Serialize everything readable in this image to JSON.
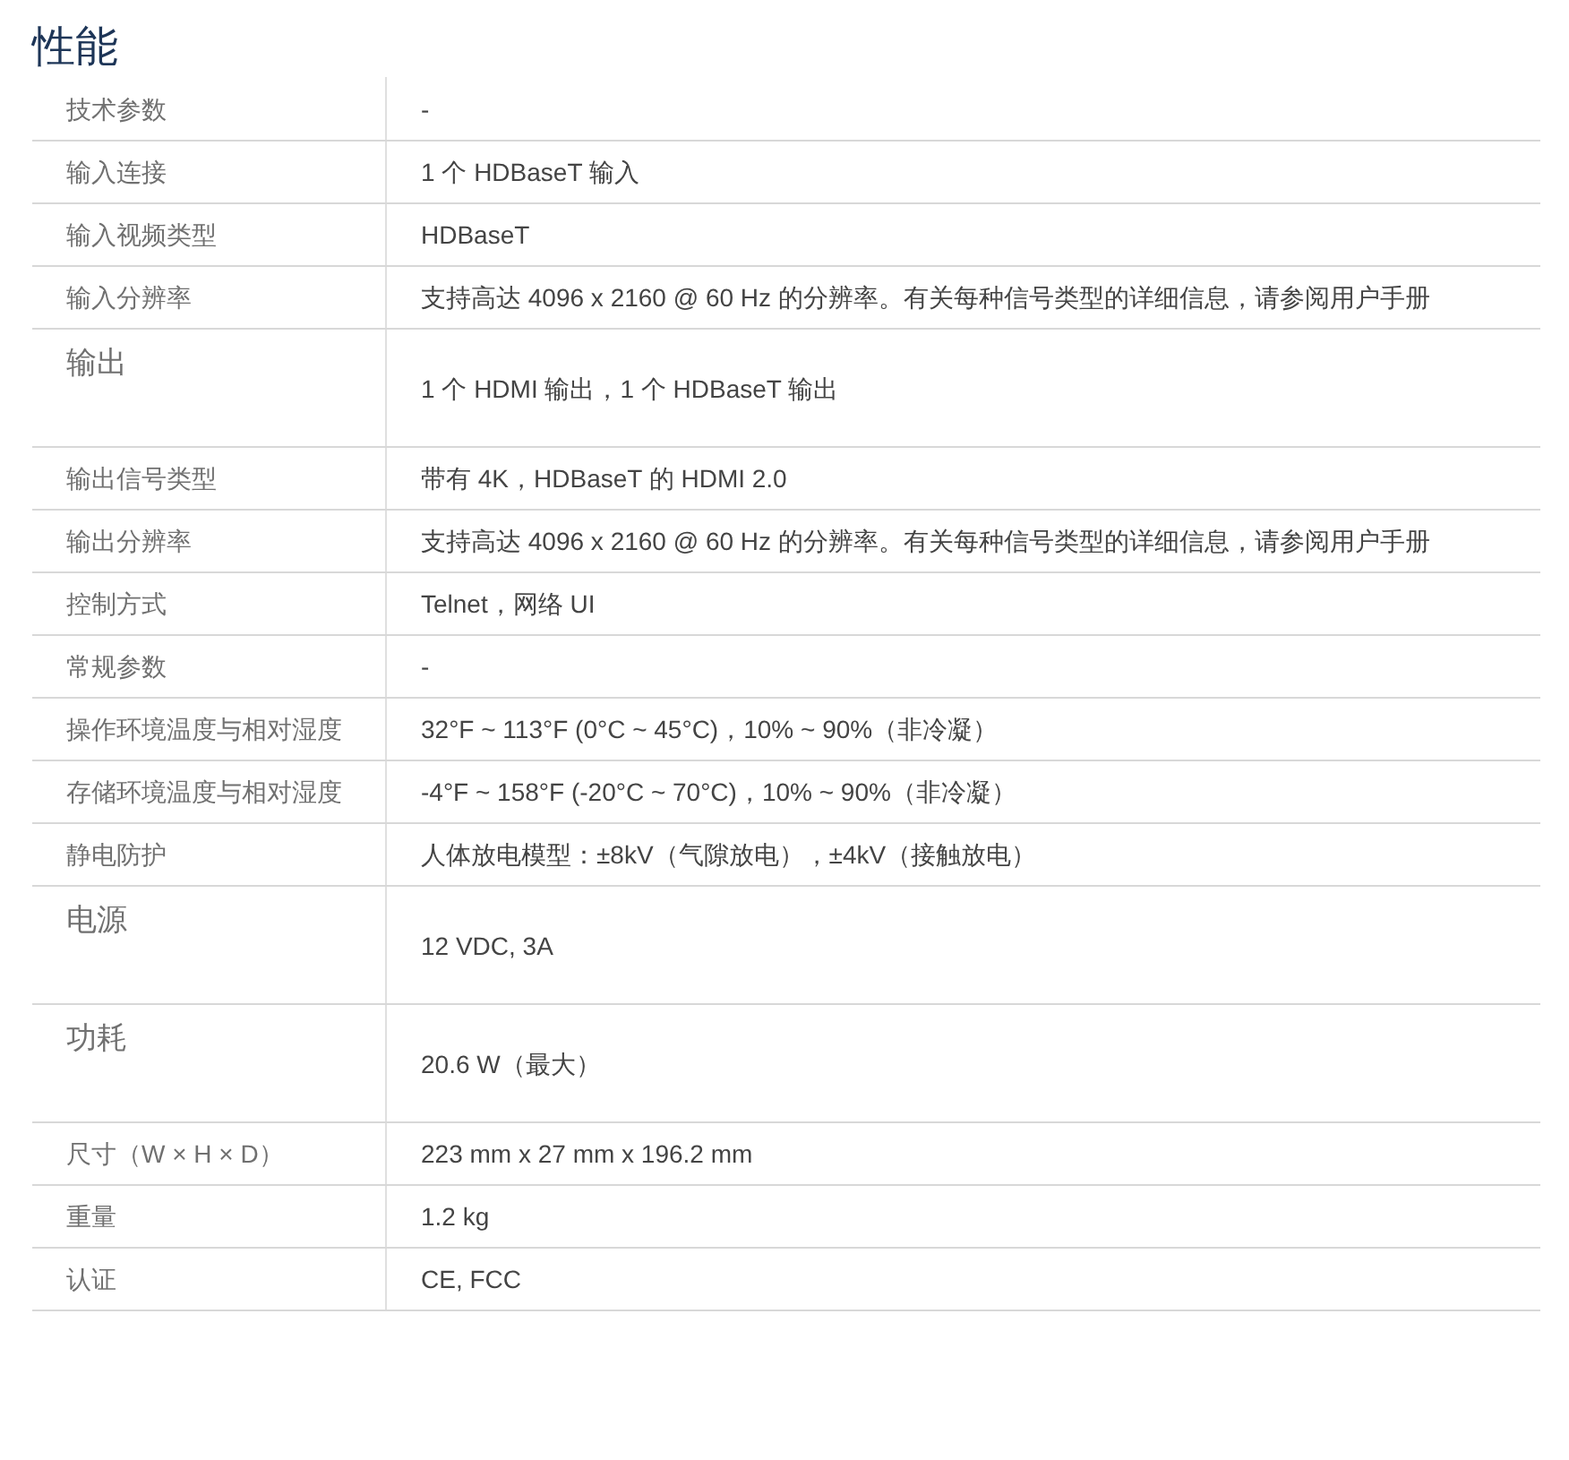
{
  "title": "性能",
  "rows": [
    {
      "label": "技术参数",
      "value": "-",
      "kind": "plain"
    },
    {
      "label": "输入连接",
      "value": "1 个 HDBaseT 输入",
      "kind": "plain"
    },
    {
      "label": "输入视频类型",
      "value": "HDBaseT",
      "kind": "plain"
    },
    {
      "label": "输入分辨率",
      "value": "支持高达 4096 x 2160 @ 60 Hz 的分辨率。有关每种信号类型的详细信息，请参阅用户手册",
      "kind": "plain"
    },
    {
      "label": "输出",
      "value": "1 个 HDMI 输出，1 个 HDBaseT 输出",
      "kind": "tall"
    },
    {
      "label": "输出信号类型",
      "value": "带有 4K，HDBaseT 的 HDMI 2.0",
      "kind": "plain"
    },
    {
      "label": "输出分辨率",
      "value": "支持高达 4096 x 2160 @ 60 Hz 的分辨率。有关每种信号类型的详细信息，请参阅用户手册",
      "kind": "plain"
    },
    {
      "label": "控制方式",
      "value": "Telnet，网络 UI",
      "kind": "plain"
    },
    {
      "label": "常规参数",
      "value": "-",
      "kind": "plain"
    },
    {
      "label": "操作环境温度与相对湿度",
      "value": "32°F ~ 113°F (0°C ~ 45°C)，10% ~ 90%（非冷凝）",
      "kind": "plain"
    },
    {
      "label": "存储环境温度与相对湿度",
      "value": "-4°F ~ 158°F (-20°C ~ 70°C)，10% ~ 90%（非冷凝）",
      "kind": "plain"
    },
    {
      "label": "静电防护",
      "value": "人体放电模型：±8kV（气隙放电），±4kV（接触放电）",
      "kind": "plain"
    },
    {
      "label": "电源",
      "value": "12 VDC, 3A",
      "kind": "tall"
    },
    {
      "label": "功耗",
      "value": "20.6 W（最大）",
      "kind": "tall"
    },
    {
      "label": "尺寸（W × H × D）",
      "value": "223 mm x 27 mm x 196.2 mm",
      "kind": "plain"
    },
    {
      "label": "重量",
      "value": "1.2 kg",
      "kind": "plain"
    },
    {
      "label": "认证",
      "value": "CE, FCC",
      "kind": "plain"
    }
  ]
}
